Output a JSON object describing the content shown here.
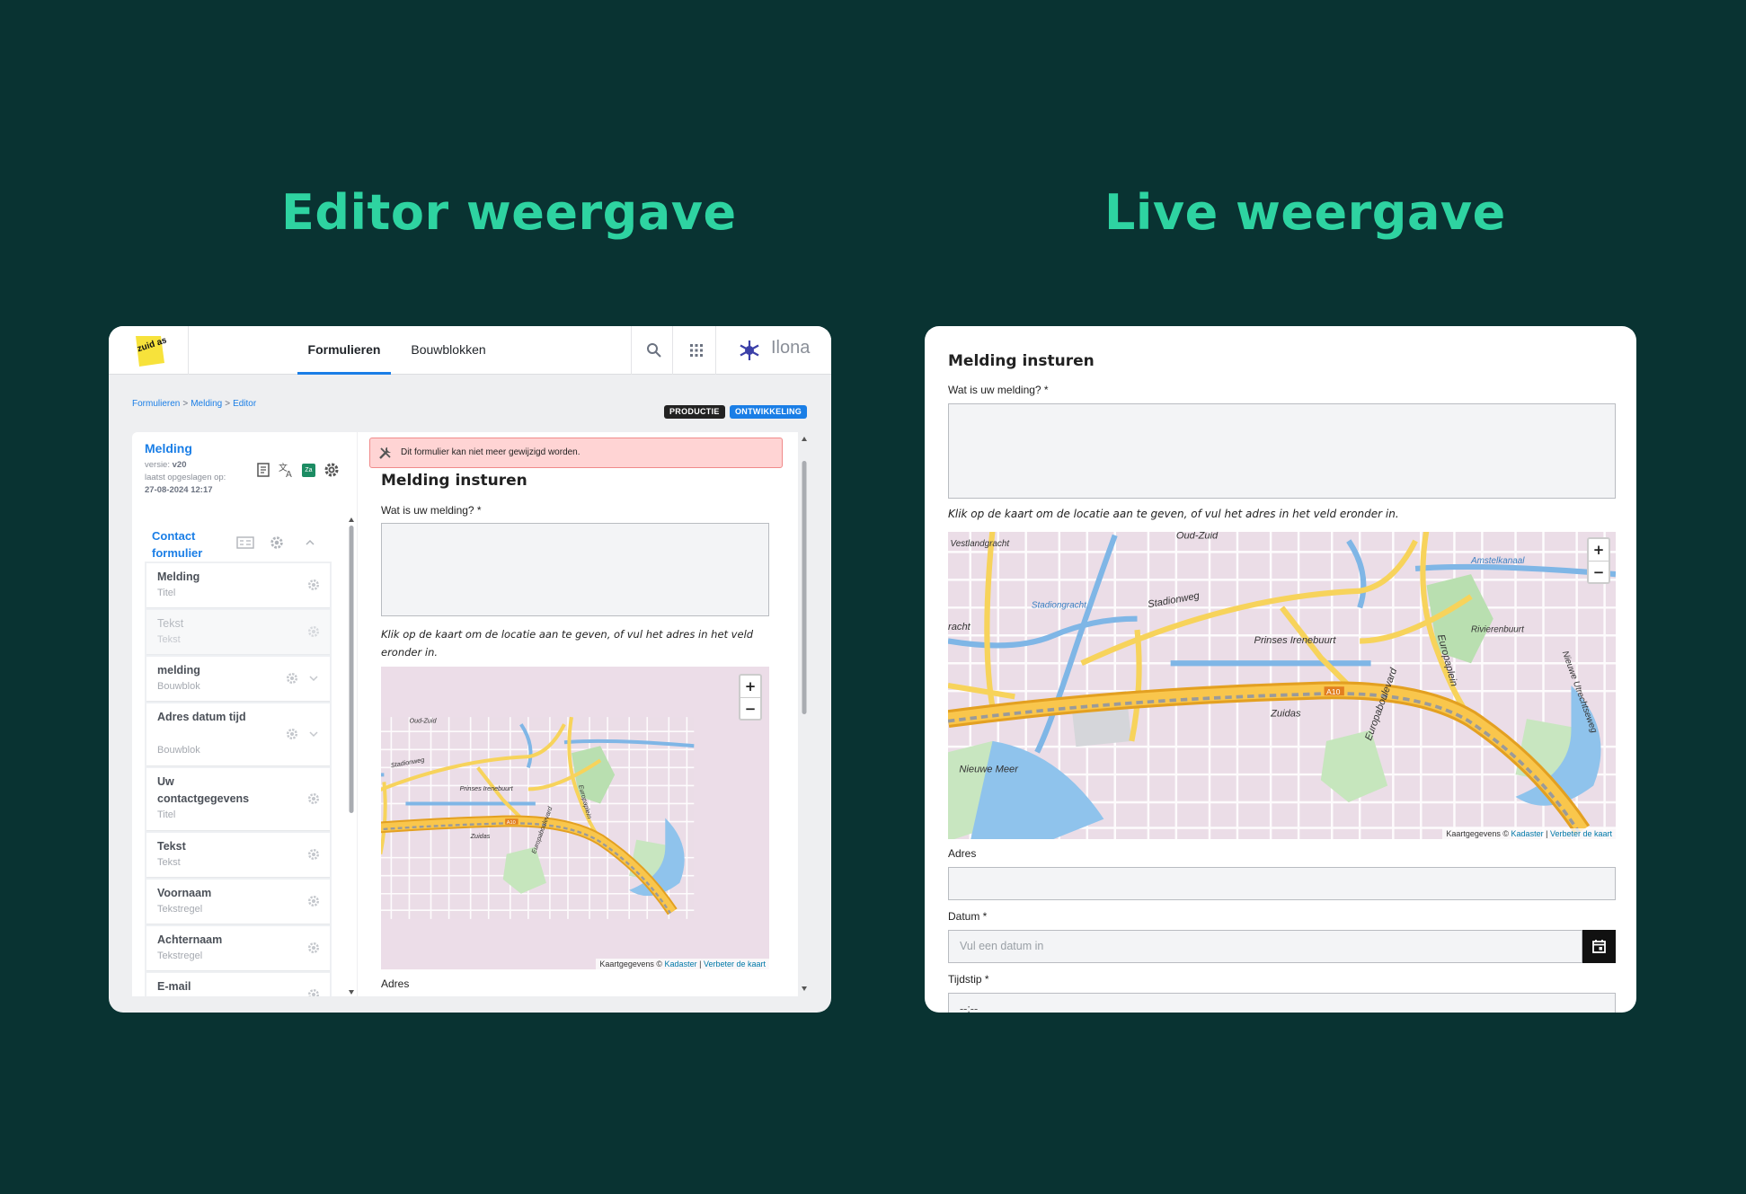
{
  "headings": {
    "editor": "Editor weergave",
    "live": "Live weergave"
  },
  "editor": {
    "logo_text": "zuid as.",
    "nav": {
      "tab1": "Formulieren",
      "tab2": "Bouwblokken"
    },
    "user_name": "Ilona",
    "breadcrumb": {
      "b1": "Formulieren",
      "b2": "Melding",
      "b3": "Editor"
    },
    "env": {
      "prod": "PRODUCTIE",
      "dev": "ONTWIKKELING"
    },
    "form": {
      "title": "Melding",
      "version_label": "versie:",
      "version": "v20",
      "saved_label": "laatst opgeslagen op:",
      "saved": "27-08-2024 12:17",
      "badge": "Za"
    },
    "tree": {
      "head": "Contact formulier",
      "items": [
        {
          "name": "Melding",
          "sub": "Titel"
        },
        {
          "name": "Tekst",
          "sub": "Tekst"
        },
        {
          "name": "melding",
          "sub": "Bouwblok"
        },
        {
          "name": "Adres datum tijd",
          "sub": "Bouwblok"
        },
        {
          "name": "Uw contactgegevens",
          "sub": "Titel"
        },
        {
          "name": "Tekst",
          "sub": "Tekst"
        },
        {
          "name": "Voornaam",
          "sub": "Tekstregel"
        },
        {
          "name": "Achternaam",
          "sub": "Tekstregel"
        },
        {
          "name": "E-mail",
          "sub": ""
        }
      ]
    },
    "warning": "Dit formulier kan niet meer gewijzigd worden.",
    "preview": {
      "title": "Melding insturen",
      "question": "Wat is uw melding? *",
      "hint": "Klik op de kaart om de locatie aan te geven, of vul het adres in het veld eronder in.",
      "address_label": "Adres"
    }
  },
  "map": {
    "labels": {
      "oud_zuid": "Oud-Zuid",
      "stadionweg": "Stadionweg",
      "prinses": "Prinses Irenebuurt",
      "europaplein": "Europaplein",
      "europaboulevard": "Europaboulevard",
      "zuidas": "Zuidas",
      "a10": "A10",
      "nieuwe_meer": "Nieuwe Meer",
      "vestlandgracht": "Vestlandgracht",
      "stadiongracht": "Stadiongracht",
      "amstelkanaal": "Amstelkanaal",
      "rivierenbuurt": "Rivierenbuurt",
      "nieuwe_utrechtseweg": "Nieuwe Utrechtseweg",
      "racht": "racht"
    },
    "attribution": {
      "prefix": "Kaartgegevens ©",
      "kadaster": "Kadaster",
      "sep": "|",
      "improve": "Verbeter de kaart"
    },
    "zoom_in": "+",
    "zoom_out": "−"
  },
  "live": {
    "title": "Melding insturen",
    "question": "Wat is uw melding? *",
    "hint": "Klik op de kaart om de locatie aan te geven, of vul het adres in het veld eronder in.",
    "address_label": "Adres",
    "date_label": "Datum *",
    "date_placeholder": "Vul een datum in",
    "time_label": "Tijdstip *",
    "time_value": "--:--"
  },
  "colors": {
    "background": "#093332",
    "heading": "#2ed3a1",
    "accent": "#1a7ee6",
    "warning_bg": "#ffd4d4"
  }
}
